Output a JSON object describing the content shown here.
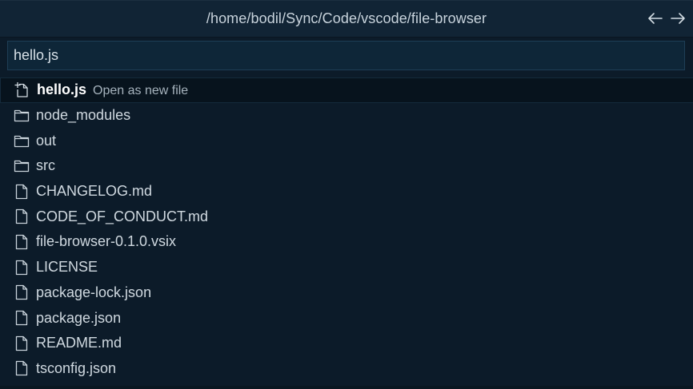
{
  "header": {
    "title": "/home/bodil/Sync/Code/vscode/file-browser",
    "back_icon": "arrow-left-icon",
    "forward_icon": "arrow-right-icon"
  },
  "search": {
    "value": "hello.js",
    "placeholder": ""
  },
  "items": [
    {
      "label": "hello.js",
      "description": "Open as new file",
      "icon": "new-file-icon",
      "selected": true
    },
    {
      "label": "node_modules",
      "description": "",
      "icon": "folder-icon"
    },
    {
      "label": "out",
      "description": "",
      "icon": "folder-icon"
    },
    {
      "label": "src",
      "description": "",
      "icon": "folder-icon"
    },
    {
      "label": "CHANGELOG.md",
      "description": "",
      "icon": "file-icon"
    },
    {
      "label": "CODE_OF_CONDUCT.md",
      "description": "",
      "icon": "file-icon"
    },
    {
      "label": "file-browser-0.1.0.vsix",
      "description": "",
      "icon": "file-icon"
    },
    {
      "label": "LICENSE",
      "description": "",
      "icon": "file-icon"
    },
    {
      "label": "package-lock.json",
      "description": "",
      "icon": "file-icon"
    },
    {
      "label": "package.json",
      "description": "",
      "icon": "file-icon"
    },
    {
      "label": "README.md",
      "description": "",
      "icon": "file-icon"
    },
    {
      "label": "tsconfig.json",
      "description": "",
      "icon": "file-icon"
    }
  ],
  "colors": {
    "background": "#0c1b29",
    "titlebar": "#112435",
    "input_background": "#0e2638",
    "text": "#d0d9e0",
    "selected_row": "#07131d"
  }
}
